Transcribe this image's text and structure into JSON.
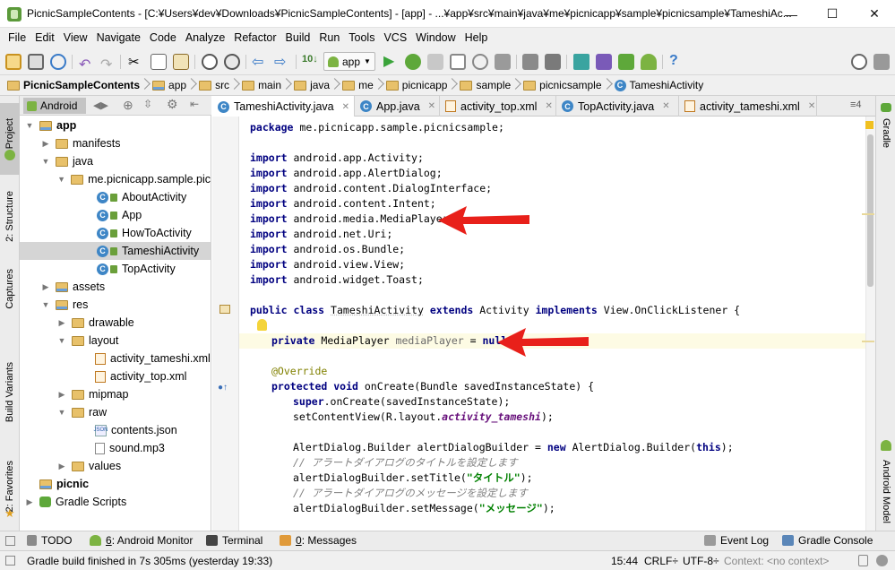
{
  "window": {
    "title": "PicnicSampleContents - [C:¥Users¥dev¥Downloads¥PicnicSampleContents] - [app] - ...¥app¥src¥main¥java¥me¥picnicapp¥sample¥picnicsample¥TameshiAc..."
  },
  "menu": [
    "File",
    "Edit",
    "View",
    "Navigate",
    "Code",
    "Analyze",
    "Refactor",
    "Build",
    "Run",
    "Tools",
    "VCS",
    "Window",
    "Help"
  ],
  "toolbar": {
    "run_config": "app"
  },
  "breadcrumb": [
    "PicnicSampleContents",
    "app",
    "src",
    "main",
    "java",
    "me",
    "picnicapp",
    "sample",
    "picnicsample",
    "TameshiActivity"
  ],
  "left_tabs": {
    "project": "1: Project",
    "structure": "2: Structure",
    "captures": "Captures",
    "build_variants": "Build Variants",
    "favorites": "2: Favorites"
  },
  "right_tabs": {
    "gradle": "Gradle",
    "android_model": "Android Model"
  },
  "project_panel": {
    "view": "Android",
    "tree": [
      "app",
      "manifests",
      "java",
      "me.picnicapp.sample.pic",
      "AboutActivity",
      "App",
      "HowToActivity",
      "TameshiActivity",
      "TopActivity",
      "assets",
      "res",
      "drawable",
      "layout",
      "activity_tameshi.xml",
      "activity_top.xml",
      "mipmap",
      "raw",
      "contents.json",
      "sound.mp3",
      "values",
      "picnic",
      "Gradle Scripts"
    ]
  },
  "editor_tabs": [
    "TameshiActivity.java",
    "App.java",
    "activity_top.xml",
    "TopActivity.java",
    "activity_tameshi.xml"
  ],
  "editor_tab_overflow": "≡4",
  "code": {
    "package_line": "me.picnicapp.sample.picnicsample;",
    "imports": [
      "android.app.Activity;",
      "android.app.AlertDialog;",
      "android.content.DialogInterface;",
      "android.content.Intent;",
      "android.media.MediaPlayer;",
      "android.net.Uri;",
      "android.os.Bundle;",
      "android.view.View;",
      "android.widget.Toast;"
    ],
    "kw_package": "package",
    "kw_import": "import",
    "kw_public": "public",
    "kw_class": "class",
    "kw_extends": "extends",
    "kw_implements": "implements",
    "kw_private": "private",
    "kw_null": "null",
    "kw_protected": "protected",
    "kw_void": "void",
    "kw_super": "super",
    "kw_new": "new",
    "kw_this": "this",
    "class_name": "TameshiActivity",
    "base_class": "Activity",
    "interface": "View.OnClickListener {",
    "field_type": "MediaPlayer",
    "field_name": "mediaPlayer",
    "field_rest": " = ",
    "annotation": "@Override",
    "oncreate_sig": " onCreate(Bundle savedInstanceState) {",
    "super_call": ".onCreate(savedInstanceState);",
    "set_content_a": "setContentView(R.layout.",
    "set_content_field": "activity_tameshi",
    "set_content_b": ");",
    "builder_a": "AlertDialog.Builder alertDialogBuilder = ",
    "builder_b": " AlertDialog.Builder(",
    "builder_c": ");",
    "comment_title": "// アラートダイアログのタイトルを設定します",
    "set_title_a": "alertDialogBuilder.setTitle(",
    "set_title_str": "\"タイトル\"",
    "set_title_b": ");",
    "comment_message": "// アラートダイアログのメッセージを設定します",
    "set_message_a": "alertDialogBuilder.setMessage(",
    "set_message_str": "\"メッセージ\"",
    "set_message_b": ");"
  },
  "bottom_tools": {
    "todo": "TODO",
    "monitor_num": "6",
    "monitor": ": Android Monitor",
    "terminal": "Terminal",
    "messages_num": "0",
    "messages": ": Messages",
    "event_log": "Event Log",
    "gradle_console": "Gradle Console"
  },
  "status": {
    "message": "Gradle build finished in 7s 305ms (yesterday 19:33)",
    "position": "15:44",
    "line_sep": "CRLF÷",
    "encoding": "UTF-8÷",
    "context": "Context: <no context>"
  },
  "colors": {
    "keyword": "#000080",
    "annotation_arrow": "#e8201a",
    "string": "#008000",
    "field": "#660e7a"
  }
}
